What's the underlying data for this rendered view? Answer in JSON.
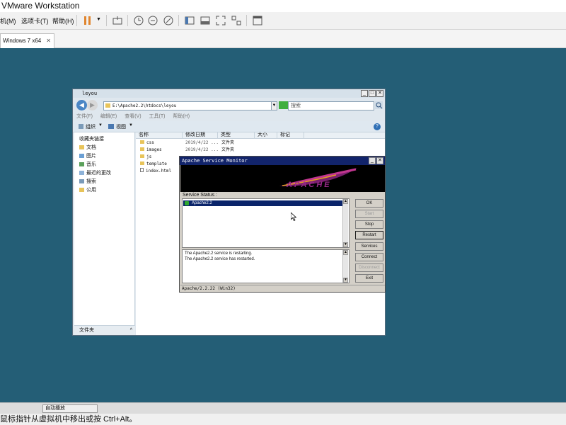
{
  "vmware": {
    "title": "VMware Workstation",
    "menu": [
      "机(M)",
      "选项卡(T)",
      "帮助(H)"
    ],
    "tab": "Windows 7 x64",
    "taskbar_button": "自动播放",
    "status_text": "鼠标指针从虚拟机中移出或按 Ctrl+Alt。"
  },
  "explorer": {
    "title": "leyou",
    "address": "E:\\Apache2.2\\htdocs\\leyou",
    "search_placeholder": "搜索",
    "menu": [
      "文件(F)",
      "编辑(E)",
      "查看(V)",
      "工具(T)",
      "帮助(H)"
    ],
    "cmd_organize": "组织",
    "cmd_view": "视图",
    "nav": {
      "favorites_header": "收藏夹链接",
      "items": [
        "文档",
        "图片",
        "音乐",
        "最近的更改",
        "搜索",
        "公用"
      ],
      "footer": "文件夹"
    },
    "columns": [
      "名称",
      "修改日期",
      "类型",
      "大小",
      "标记"
    ],
    "files": [
      {
        "name": "css",
        "date": "2019/4/22 ...",
        "type": "文件夹",
        "kind": "folder"
      },
      {
        "name": "images",
        "date": "2019/4/22 ...",
        "type": "文件夹",
        "kind": "folder"
      },
      {
        "name": "js",
        "date": "",
        "type": "",
        "kind": "folder"
      },
      {
        "name": "template",
        "date": "",
        "type": "",
        "kind": "folder"
      },
      {
        "name": "index.html",
        "date": "",
        "type": "",
        "kind": "html"
      }
    ]
  },
  "asm": {
    "title": "Apache Service Monitor",
    "logo_text": "APACHE",
    "status_label": "Service Status :",
    "service": "Apache2.2",
    "log": [
      "The Apache2.2 service is restarting.",
      "The Apache2.2 service has restarted."
    ],
    "buttons": [
      {
        "label": "OK",
        "enabled": true
      },
      {
        "label": "Start",
        "enabled": false
      },
      {
        "label": "Stop",
        "enabled": true
      },
      {
        "label": "Restart",
        "enabled": true
      },
      {
        "label": "Services",
        "enabled": true
      },
      {
        "label": "Connect",
        "enabled": true
      },
      {
        "label": "Disconnect",
        "enabled": false
      },
      {
        "label": "Exit",
        "enabled": true
      }
    ],
    "footer": "Apache/2.2.22 (Win32)"
  },
  "colors": {
    "desktop": "#245e76",
    "asm_titlebar": "#12246b",
    "selection": "#0a246a"
  }
}
